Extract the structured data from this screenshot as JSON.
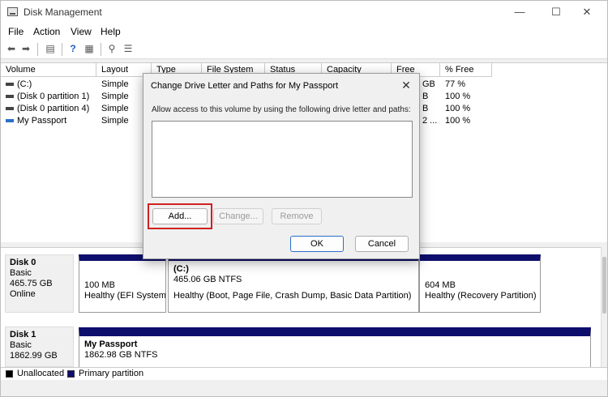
{
  "window": {
    "title": "Disk Management"
  },
  "titlebar_buttons": {
    "minimize": "—",
    "maximize": "☐",
    "close": "✕"
  },
  "menu": {
    "items": [
      "File",
      "Action",
      "View",
      "Help"
    ]
  },
  "toolbar_icons": [
    "back-arrow-icon",
    "forward-arrow-icon",
    "properties-icon",
    "help-icon",
    "console-icon",
    "rescan-icon",
    "list-icon"
  ],
  "volume_list": {
    "headers": [
      "Volume",
      "Layout",
      "Type",
      "File System",
      "Status",
      "Capacity",
      "Free Spa...",
      "% Free"
    ],
    "rows": [
      {
        "volume": "(C:)",
        "layout": "Simple",
        "free": "GB",
        "pct": "77 %"
      },
      {
        "volume": "(Disk 0 partition 1)",
        "layout": "Simple",
        "free": "B",
        "pct": "100 %"
      },
      {
        "volume": "(Disk 0 partition 4)",
        "layout": "Simple",
        "free": "B",
        "pct": "100 %"
      },
      {
        "volume": "My Passport",
        "layout": "Simple",
        "free": "2 ...",
        "pct": "100 %"
      }
    ]
  },
  "disks": [
    {
      "name": "Disk 0",
      "type": "Basic",
      "size": "465.75 GB",
      "status": "Online",
      "partitions": [
        {
          "title": "",
          "size": "100 MB",
          "health": "Healthy (EFI System"
        },
        {
          "title": "(C:)",
          "size": "465.06 GB NTFS",
          "health": "Healthy (Boot, Page File, Crash Dump, Basic Data Partition)"
        },
        {
          "title": "",
          "size": "604 MB",
          "health": "Healthy (Recovery Partition)"
        }
      ]
    },
    {
      "name": "Disk 1",
      "type": "Basic",
      "size": "1862.99 GB",
      "status": "",
      "partitions": [
        {
          "title": "My Passport",
          "size": "1862.98 GB NTFS",
          "health": ""
        }
      ]
    }
  ],
  "legend": {
    "unallocated": "Unallocated",
    "primary": "Primary partition",
    "unallocated_color": "#000000",
    "primary_color": "#0e0e6d"
  },
  "dialog": {
    "title": "Change Drive Letter and Paths for My Passport",
    "close_glyph": "✕",
    "description": "Allow access to this volume by using the following drive letter and paths:",
    "add_label": "Add...",
    "change_label": "Change...",
    "remove_label": "Remove",
    "ok_label": "OK",
    "cancel_label": "Cancel",
    "highlight_color": "#d02020"
  }
}
